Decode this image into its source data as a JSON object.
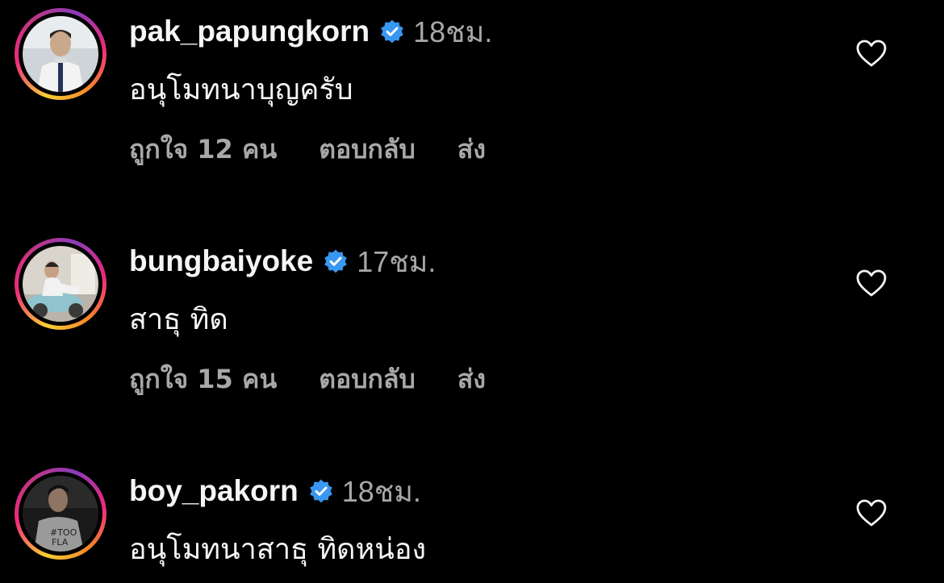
{
  "comments": [
    {
      "username": "pak_papungkorn",
      "time": "18ชม.",
      "text": "อนุโมทนาบุญครับ",
      "likes": "ถูกใจ 12 คน",
      "reply": "ตอบกลับ",
      "send": "ส่ง"
    },
    {
      "username": "bungbaiyoke",
      "time": "17ชม.",
      "text": "สาธุ ทิด",
      "likes": "ถูกใจ 15 คน",
      "reply": "ตอบกลับ",
      "send": "ส่ง"
    },
    {
      "username": "boy_pakorn",
      "time": "18ชม.",
      "text": "อนุโมทนาสาธุ ทิดหน่อง",
      "likes": "",
      "reply": "",
      "send": ""
    }
  ],
  "colors": {
    "background": "#000000",
    "primary_text": "#f5f5f5",
    "secondary_text": "#a8a8a8",
    "verified_badge": "#3897f0"
  },
  "icons": {
    "verified": "verified-badge-icon",
    "like": "heart-outline-icon"
  }
}
